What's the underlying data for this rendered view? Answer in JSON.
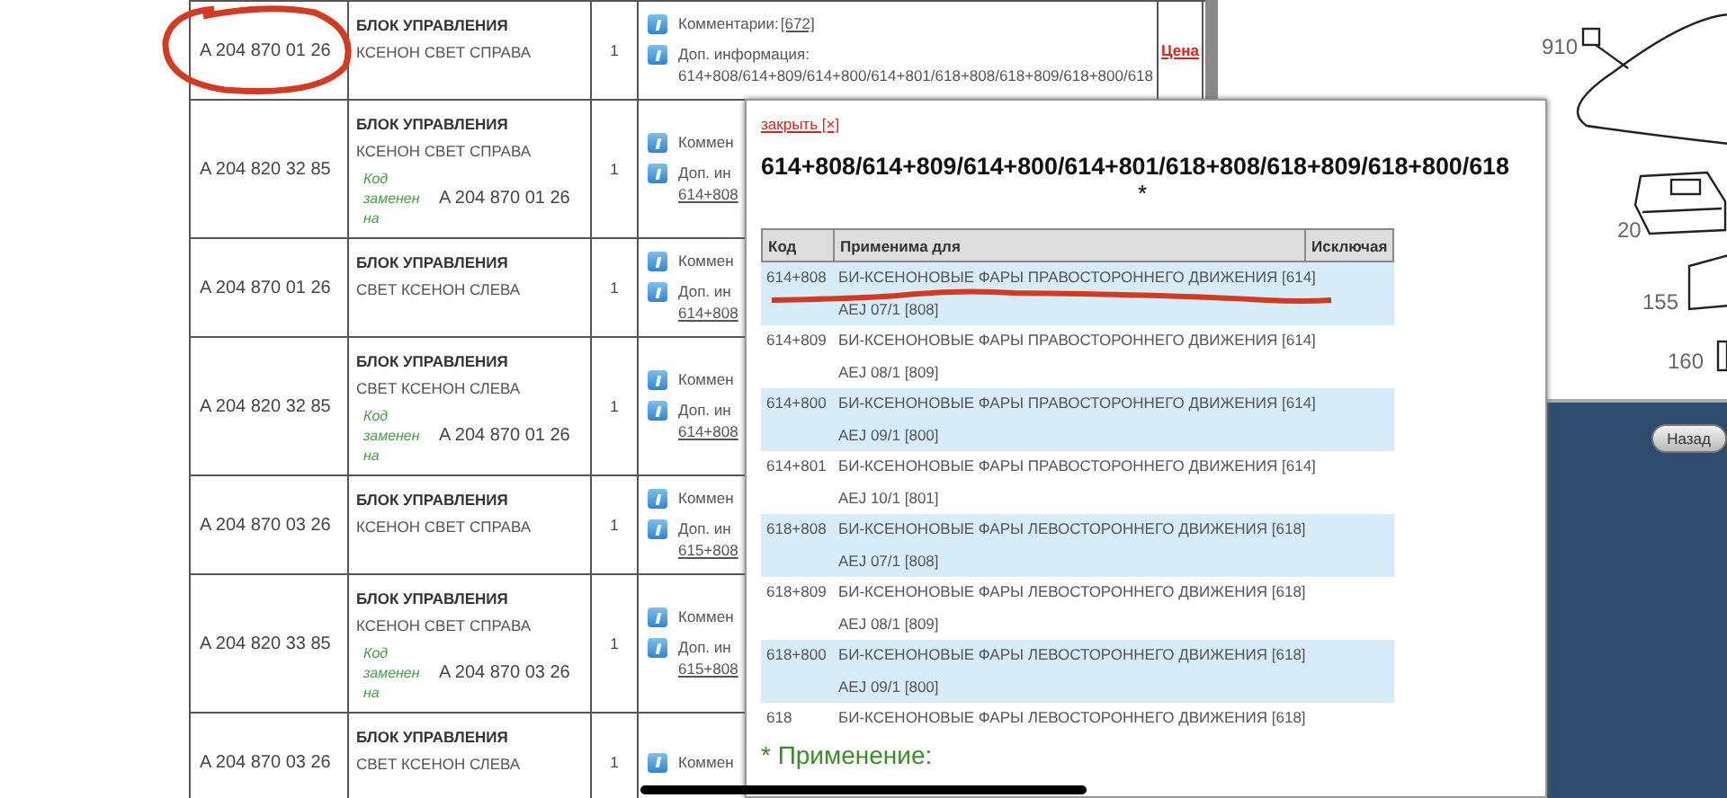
{
  "parts_table": {
    "rows": [
      {
        "circled": true,
        "code": "A 204 870 01 26",
        "name": "БЛОК УПРАВЛЕНИЯ",
        "desc": "КСЕНОН СВЕТ СПРАВА",
        "qty": "1",
        "comment_label": "Комментарии:",
        "comment_link": "[672]",
        "info_label": "Доп. информация:",
        "info_value": "614+808/614+809/614+800/614+801/618+808/618+809/618+800/618",
        "price": "Цена"
      },
      {
        "circled": false,
        "code": "A 204 820 32 85",
        "name": "БЛОК УПРАВЛЕНИЯ",
        "desc": "КСЕНОН СВЕТ СПРАВА",
        "replaced_label": "Код заменен на",
        "replaced_code": "A 204 870 01 26",
        "qty": "1",
        "comment_label": "Коммен",
        "info_label": "Доп. ин",
        "info_value": "614+808"
      },
      {
        "circled": false,
        "code": "A 204 870 01 26",
        "name": "БЛОК УПРАВЛЕНИЯ",
        "desc": "СВЕТ КСЕНОН СЛЕВА",
        "qty": "1",
        "comment_label": "Коммен",
        "info_label": "Доп. ин",
        "info_value": "614+808"
      },
      {
        "circled": false,
        "code": "A 204 820 32 85",
        "name": "БЛОК УПРАВЛЕНИЯ",
        "desc": "СВЕТ КСЕНОН СЛЕВА",
        "replaced_label": "Код заменен на",
        "replaced_code": "A 204 870 01 26",
        "qty": "1",
        "comment_label": "Коммен",
        "info_label": "Доп. ин",
        "info_value": "614+808"
      },
      {
        "circled": false,
        "code": "A 204 870 03 26",
        "name": "БЛОК УПРАВЛЕНИЯ",
        "desc": "КСЕНОН СВЕТ СПРАВА",
        "qty": "1",
        "comment_label": "Коммен",
        "info_label": "Доп. ин",
        "info_value": "615+808"
      },
      {
        "circled": false,
        "code": "A 204 820 33 85",
        "name": "БЛОК УПРАВЛЕНИЯ",
        "desc": "КСЕНОН СВЕТ СПРАВА",
        "replaced_label": "Код заменен на",
        "replaced_code": "A 204 870 03 26",
        "qty": "1",
        "comment_label": "Коммен",
        "info_label": "Доп. ин",
        "info_value": "615+808"
      },
      {
        "circled": false,
        "code": "A 204 870 03 26",
        "name": "БЛОК УПРАВЛЕНИЯ",
        "desc": "СВЕТ КСЕНОН СЛЕВА",
        "qty": "1",
        "comment_label": "Коммен"
      }
    ]
  },
  "diagram": {
    "callouts": [
      "910",
      "20",
      "155",
      "160"
    ]
  },
  "back_button": "Назад",
  "popup": {
    "close_link": "закрыть [×]",
    "title": "614+808/614+809/614+800/614+801/618+808/618+809/618+800/618",
    "footnote_mark": "*",
    "columns": [
      "Код",
      "Применима для",
      "Исключая"
    ],
    "rows": [
      {
        "underlined": true,
        "code": "614+808",
        "applies": [
          "БИ-КСЕНОНОВЫЕ ФАРЫ ПРАВОСТОРОННЕГО ДВИЖЕНИЯ [614]",
          "AEJ 07/1 [808]"
        ]
      },
      {
        "underlined": false,
        "code": "614+809",
        "applies": [
          "БИ-КСЕНОНОВЫЕ ФАРЫ ПРАВОСТОРОННЕГО ДВИЖЕНИЯ [614]",
          "AEJ 08/1 [809]"
        ]
      },
      {
        "underlined": false,
        "code": "614+800",
        "applies": [
          "БИ-КСЕНОНОВЫЕ ФАРЫ ПРАВОСТОРОННЕГО ДВИЖЕНИЯ [614]",
          "AEJ 09/1 [800]"
        ]
      },
      {
        "underlined": false,
        "code": "614+801",
        "applies": [
          "БИ-КСЕНОНОВЫЕ ФАРЫ ПРАВОСТОРОННЕГО ДВИЖЕНИЯ [614]",
          "AEJ 10/1 [801]"
        ]
      },
      {
        "underlined": false,
        "code": "618+808",
        "applies": [
          "БИ-КСЕНОНОВЫЕ ФАРЫ ЛЕВОСТОРОННЕГО ДВИЖЕНИЯ [618]",
          "AEJ 07/1 [808]"
        ]
      },
      {
        "underlined": false,
        "code": "618+809",
        "applies": [
          "БИ-КСЕНОНОВЫЕ ФАРЫ ЛЕВОСТОРОННЕГО ДВИЖЕНИЯ [618]",
          "AEJ 08/1 [809]"
        ]
      },
      {
        "underlined": false,
        "code": "618+800",
        "applies": [
          "БИ-КСЕНОНОВЫЕ ФАРЫ ЛЕВОСТОРОННЕГО ДВИЖЕНИЯ [618]",
          "AEJ 09/1 [800]"
        ]
      },
      {
        "underlined": false,
        "code": "618",
        "applies": [
          "БИ-КСЕНОНОВЫЕ ФАРЫ ЛЕВОСТОРОННЕГО ДВИЖЕНИЯ [618]"
        ]
      }
    ],
    "note_heading": "* Применение:"
  }
}
